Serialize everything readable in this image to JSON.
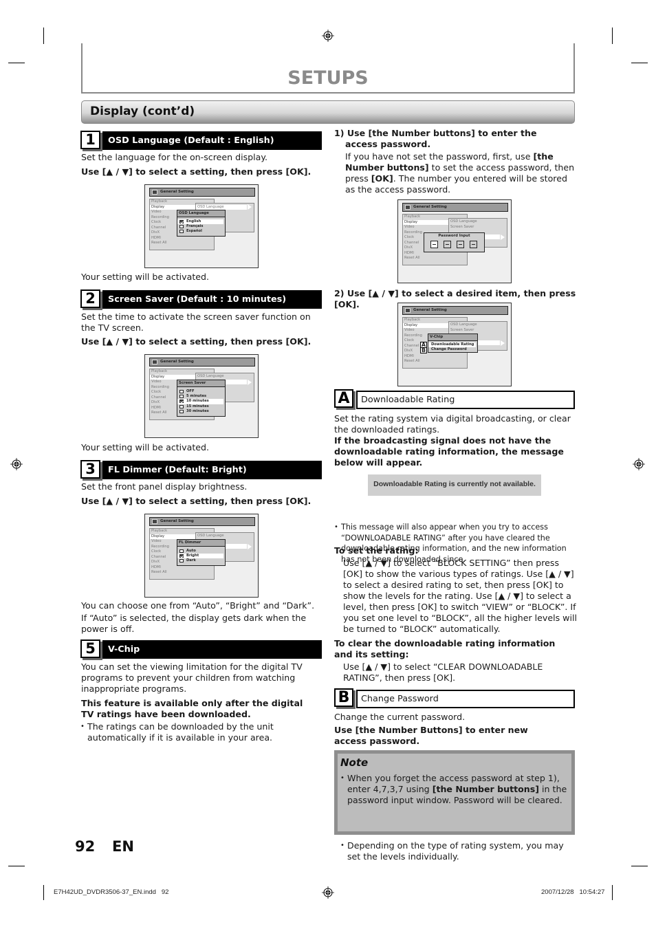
{
  "page": {
    "title": "SETUPS",
    "section_title": "Display (cont’d)",
    "page_number": "92",
    "language": "EN",
    "footer_file": "E7H42UD_DVDR3506-37_EN.indd   92",
    "footer_timestamp": "2007/12/28   10:54:27"
  },
  "osd_common": {
    "window_title": "General Setting",
    "menu_items": [
      "Playback",
      "Display",
      "Video",
      "Recording",
      "Clock",
      "Channel",
      "DivX",
      "HDMI",
      "Reset All"
    ],
    "submenu_items": [
      "OSD Language",
      "Screen Saver",
      "FL Dimmer",
      "V-Chip"
    ]
  },
  "steps": [
    {
      "number": "1",
      "title": "OSD Language (Default : English)",
      "desc": "Set the language for the on-screen display.",
      "instruction": "Use [▲ / ▼] to select a setting, then press [OK].",
      "popup_title": "OSD Language",
      "options": [
        {
          "label": "English",
          "checked": true
        },
        {
          "label": "Français",
          "checked": false
        },
        {
          "label": "Español",
          "checked": false
        }
      ],
      "after": "Your setting will be activated."
    },
    {
      "number": "2",
      "title": "Screen Saver (Default : 10 minutes)",
      "desc": "Set the time to activate the screen saver function on the TV screen.",
      "instruction": "Use [▲ / ▼] to select a setting, then press [OK].",
      "popup_title": "Screen Saver",
      "options": [
        {
          "label": "OFF",
          "checked": false
        },
        {
          "label": " 5  minutes",
          "checked": false
        },
        {
          "label": "10  minutes",
          "checked": true
        },
        {
          "label": "15  minutes",
          "checked": false
        },
        {
          "label": "30  minutes",
          "checked": false
        }
      ],
      "after": "Your setting will be activated."
    },
    {
      "number": "3",
      "title": "FL Dimmer (Default: Bright)",
      "desc": "Set the front panel display brightness.",
      "instruction": "Use [▲ / ▼] to select a setting, then press [OK].",
      "popup_title": "FL Dimmer",
      "options": [
        {
          "label": "Auto",
          "checked": false
        },
        {
          "label": "Bright",
          "checked": true
        },
        {
          "label": "Dark",
          "checked": false
        }
      ],
      "after_1": "You can choose one from “Auto”, “Bright” and “Dark”.",
      "after_2": "If “Auto” is selected, the display gets dark when the power is off."
    },
    {
      "number": "5",
      "title": "V-Chip",
      "desc": "You can set the viewing limitation for the digital TV programs to prevent your children from watching inappropriate programs.",
      "bold_note": "This feature is available only after the digital TV ratings have been downloaded.",
      "bullet": "The ratings can be downloaded by the unit automatically if it is available in your area."
    }
  ],
  "vchip": {
    "step1_title": "1) Use [the Number buttons] to enter the access password.",
    "step1_body_a": "If you have not set the password, first, use ",
    "step1_body_b": "[the Number buttons]",
    "step1_body_c": " to set the access password, then press ",
    "step1_body_d": "[OK]",
    "step1_body_e": ". The number you entered will be stored as the access password.",
    "password_popup_title": "Password Input",
    "password_digits": [
      "—",
      "—",
      "—",
      "—"
    ],
    "step2_title": "2) Use [▲ / ▼] to select a desired item, then press [OK].",
    "vchip_popup_title": "V-Chip",
    "vchip_options": [
      {
        "letter": "A",
        "label": "Downloadable Rating"
      },
      {
        "letter": "B",
        "label": "Change Password"
      }
    ]
  },
  "section_a": {
    "letter": "A",
    "title": "Downloadable Rating",
    "desc": "Set the rating system via digital broadcasting, or clear the downloaded ratings.",
    "bold": "If the broadcasting signal does not have the downloadable rating information, the message below will appear.",
    "message": "Downloadable Rating is currently not available.",
    "bullet": "This message will also appear when you try to access “DOWNLOADABLE RATING” after you have cleared the downloadable rating information, and the new information has not been downloaded since.",
    "set_heading": "To set the rating:",
    "set_body": "Use [▲ / ▼] to select “BLOCK SETTING” then press [OK] to show the various types of ratings. Use [▲ / ▼] to select a desired rating to set, then press [OK] to show the levels for the rating. Use [▲ / ▼] to select a level, then press [OK] to switch “VIEW” or “BLOCK”. If you set one level to “BLOCK”, all the higher levels will be turned to “BLOCK” automatically.",
    "clear_heading": "To clear the downloadable rating information and its setting:",
    "clear_body": "Use [▲ / ▼] to select “CLEAR DOWNLOADABLE RATING”, then press [OK]."
  },
  "section_b": {
    "letter": "B",
    "title": "Change Password",
    "desc": "Change the current password.",
    "bold": "Use [the Number Buttons] to enter new access password."
  },
  "note": {
    "title": "Note",
    "item1_a": "When you forget the access password at step 1), enter 4,7,3,7 using ",
    "item1_b": "[the Number buttons]",
    "item1_c": " in the password input window. Password will be cleared.",
    "item2": "Depending on the type of rating system, you may set the levels individually."
  }
}
